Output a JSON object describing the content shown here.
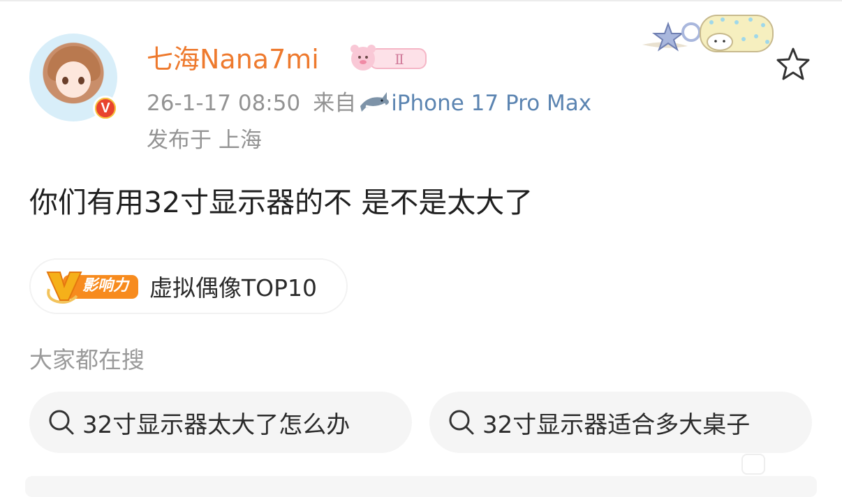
{
  "post": {
    "author": {
      "name": "七海Nana7mi",
      "avatar_icon": "anime-girl-avatar",
      "verify_icon": "v-verified-badge",
      "verify_letter": "V",
      "member_icon": "pink-bear-member-badge",
      "member_level": "Ⅱ"
    },
    "time": "26-1-17 08:50",
    "source_prefix": "来自",
    "source_icon": "shark-icon",
    "device": "iPhone 17 Pro Max",
    "location": "发布于 上海",
    "content": "你们有用32寸显示器的不 是不是太大了",
    "favorite_icon": "star-outline-icon",
    "decoration_icon": "star-sheep-decoration"
  },
  "topic": {
    "badge_label": "影响力",
    "label": "虚拟偶像TOP10"
  },
  "search": {
    "heading": "大家都在搜",
    "suggestions": [
      "32寸显示器太大了怎么办",
      "32寸显示器适合多大桌子"
    ]
  },
  "colors": {
    "username": "#ee7a2e",
    "device_link": "#5b84b1",
    "meta_gray": "#939393",
    "pill_bg": "#f5f5f5",
    "badge_orange": "#f78b1e"
  }
}
